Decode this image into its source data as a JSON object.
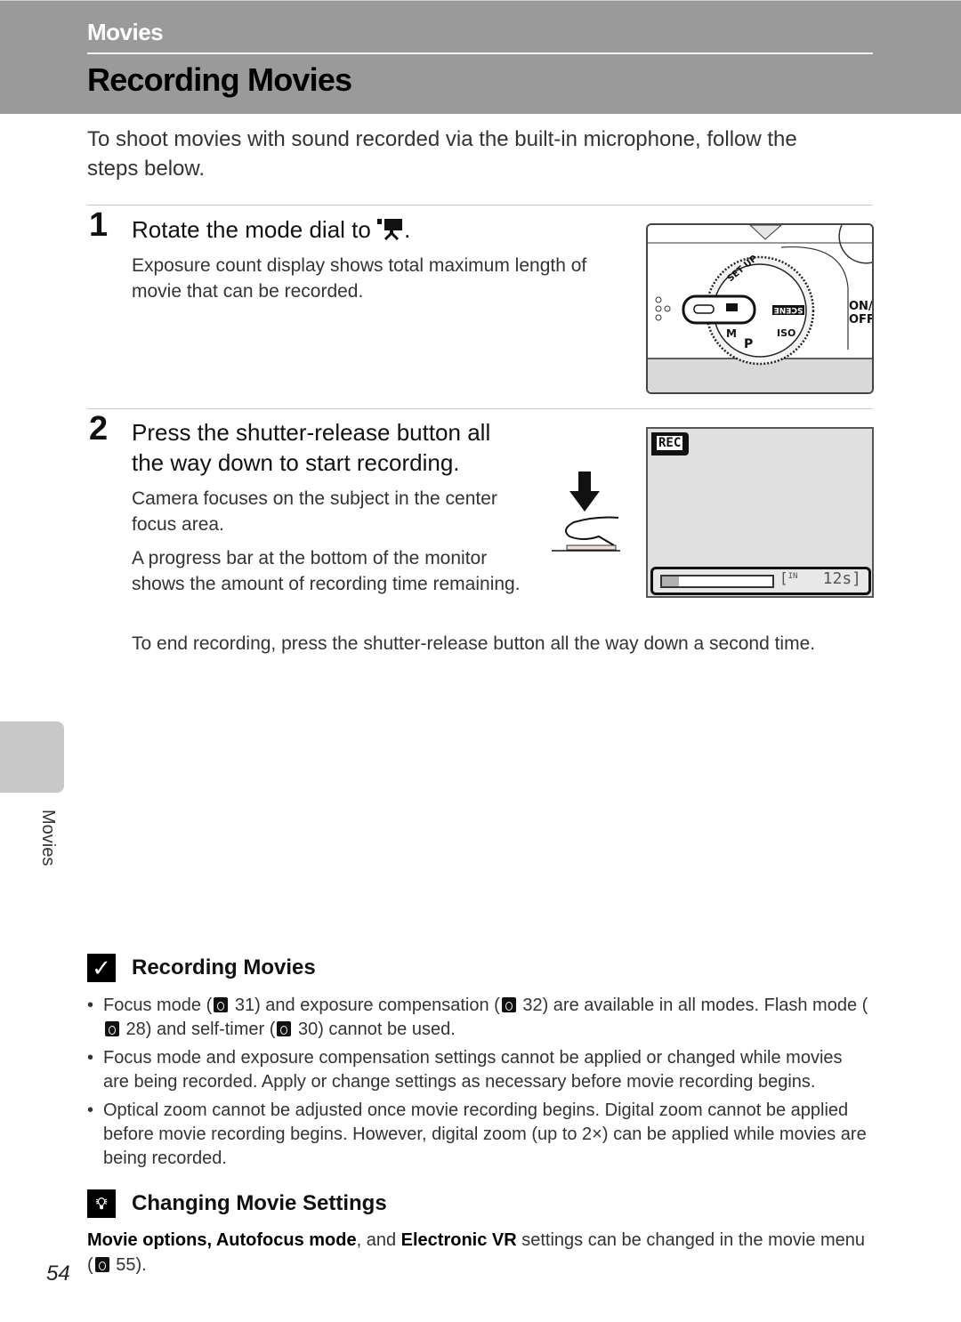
{
  "header": {
    "section": "Movies",
    "title": "Recording Movies"
  },
  "intro": "To shoot movies with sound recorded via the built-in microphone, follow the steps below.",
  "steps": [
    {
      "number": "1",
      "title": "Rotate the mode dial to",
      "title_icon": "movie-camera-icon",
      "title_end": ".",
      "paragraphs": [
        "Exposure count display shows total maximum length of movie that can be recorded."
      ],
      "figure": {
        "dial_labels": [
          "SET UP",
          "SCENE",
          "ISO",
          "P",
          "M"
        ],
        "power_label": "ON/ OFF"
      }
    },
    {
      "number": "2",
      "title": "Press the shutter-release button all the way down to start recording.",
      "paragraphs": [
        "Camera focuses on the subject in the center focus area.",
        "A progress bar at the bottom of the monitor shows the amount of recording time remaining."
      ],
      "end_text": "To end recording, press the shutter-release button all the way down a second time.",
      "figure": {
        "rec_label": "REC",
        "memory_label": "IN",
        "time_remaining": "12s",
        "progress_fraction": 0.15
      }
    }
  ],
  "side_tab": {
    "label": "Movies"
  },
  "notes": [
    {
      "icon": "check-icon",
      "title": "Recording Movies",
      "bullets": [
        {
          "parts": [
            "Focus mode (",
            "{ref}",
            " 31) and exposure compensation (",
            "{ref}",
            " 32) are available in all modes. Flash mode (",
            "{ref}",
            " 28) and self-timer (",
            "{ref}",
            " 30) cannot be used."
          ]
        },
        {
          "parts": [
            "Focus mode and exposure compensation settings cannot be applied or changed while movies are being recorded. Apply or change settings as necessary before movie recording begins."
          ]
        },
        {
          "parts": [
            "Optical zoom cannot be adjusted once movie recording begins. Digital zoom cannot be applied before movie recording begins. However, digital zoom (up to 2×) can be applied while movies are being recorded."
          ]
        }
      ]
    },
    {
      "icon": "lightbulb-icon",
      "title": "Changing Movie Settings",
      "text_bold_1": "Movie options, Autofocus mode",
      "text_1": ", and ",
      "text_bold_2": "Electronic VR",
      "text_2": " settings can be changed in the movie menu (",
      "ref_page": " 55)."
    }
  ],
  "page_number": "54"
}
